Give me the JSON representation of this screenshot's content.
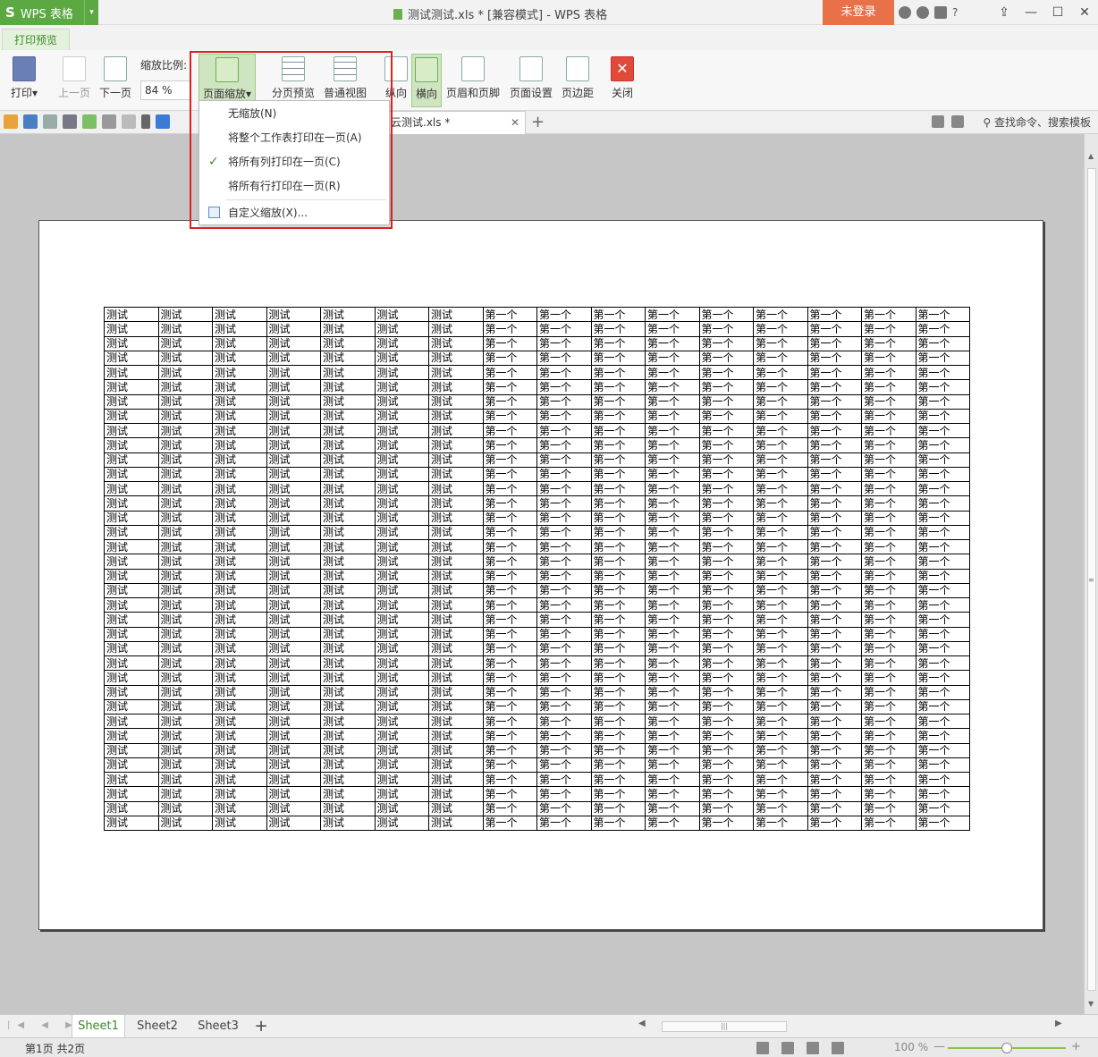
{
  "titlebar": {
    "app_logo": "S",
    "app_name": "WPS 表格",
    "dropdown_arrow": "▾",
    "doc_title": "测试测试.xls * [兼容模式] - WPS 表格",
    "login": "未登录",
    "help": "?",
    "min": "—",
    "max": "☐",
    "close": "✕"
  },
  "tabs": {
    "active": "打印预览"
  },
  "ribbon": {
    "print": "打印",
    "print_arrow": "▾",
    "prev_page": "上一页",
    "next_page": "下一页",
    "zoom_label": "缩放比例:",
    "zoom_value": "84 %",
    "page_scale": "页面缩放",
    "page_scale_arrow": "▾",
    "page_break_preview": "分页预览",
    "normal_view": "普通视图",
    "portrait": "纵向",
    "landscape": "横向",
    "header_footer": "页眉和页脚",
    "page_setup": "页面设置",
    "margins": "页边距",
    "close": "关闭",
    "close_glyph": "✕"
  },
  "quickaccess": {
    "file_tab": "测试.xls *",
    "file_tab_prefix": "云",
    "file_tab_close": "✕",
    "new_tab": "+",
    "search": "查找命令、搜索模板"
  },
  "dropdown_menu": {
    "items": [
      {
        "label": "无缩放(N)",
        "checked": false
      },
      {
        "label": "将整个工作表打印在一页(A)",
        "checked": false
      },
      {
        "label": "将所有列打印在一页(C)",
        "checked": true
      },
      {
        "label": "将所有行打印在一页(R)",
        "checked": false
      }
    ],
    "check_glyph": "✓",
    "custom": "自定义缩放(X)..."
  },
  "sheet": {
    "rows": 36,
    "cell_a": "测试",
    "cell_b": "第一个",
    "cols_a": 7,
    "cols_b": 9
  },
  "scroll": {
    "up": "▲",
    "down": "▼",
    "grip": "≡",
    "left": "◀",
    "right": "▶",
    "hgrip": "|||"
  },
  "sheetbar": {
    "nav": "|◀ ◀ ▶ ▶|",
    "tabs": [
      "Sheet1",
      "Sheet2",
      "Sheet3"
    ],
    "add": "+"
  },
  "statusbar": {
    "page_info": "第1页 共2页",
    "zoom": "100 %",
    "zoom_out": "—",
    "zoom_in": "+",
    "zoom_level": 0.5
  }
}
